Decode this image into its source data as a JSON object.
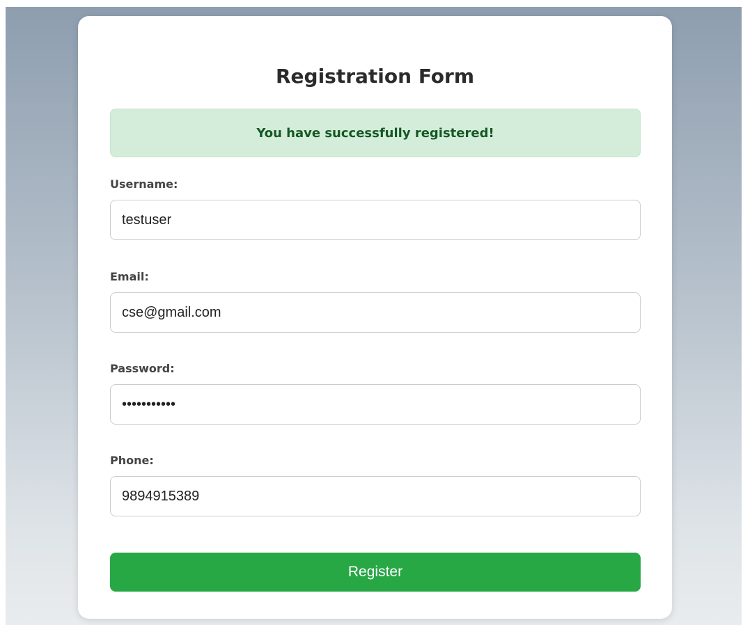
{
  "form": {
    "title": "Registration Form",
    "success_message": "You have successfully registered!",
    "fields": {
      "username": {
        "label": "Username:",
        "value": "testuser"
      },
      "email": {
        "label": "Email:",
        "value": "cse@gmail.com"
      },
      "password": {
        "label": "Password:",
        "value": "•••••••••••"
      },
      "phone": {
        "label": "Phone:",
        "value": "9894915389"
      }
    },
    "submit_label": "Register"
  },
  "colors": {
    "success_bg": "#d4edda",
    "success_text": "#155724",
    "button_bg": "#28a745"
  }
}
